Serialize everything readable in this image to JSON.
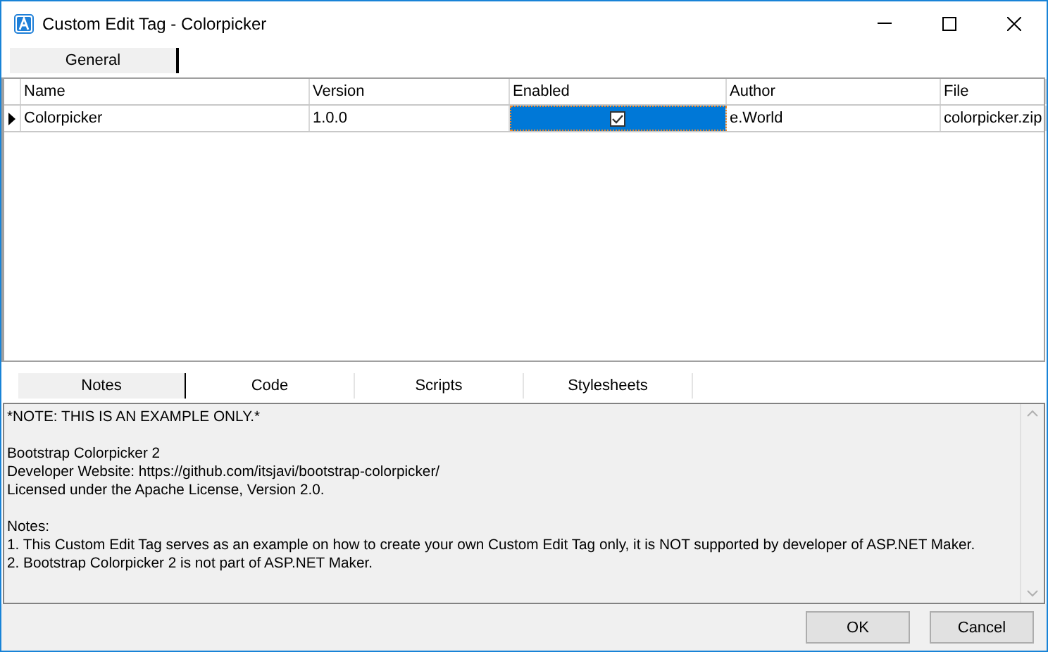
{
  "window": {
    "title": "Custom Edit Tag - Colorpicker"
  },
  "top_tabs": [
    {
      "label": "General",
      "selected": true
    }
  ],
  "table": {
    "columns": [
      "Name",
      "Version",
      "Enabled",
      "Author",
      "File"
    ],
    "rows": [
      {
        "current": true,
        "name": "Colorpicker",
        "version": "1.0.0",
        "enabled": true,
        "enabled_selected": true,
        "author": "e.World",
        "file": "colorpicker.zip"
      }
    ]
  },
  "bottom_tabs": [
    {
      "label": "Notes",
      "selected": true
    },
    {
      "label": "Code",
      "selected": false
    },
    {
      "label": "Scripts",
      "selected": false
    },
    {
      "label": "Stylesheets",
      "selected": false
    }
  ],
  "notes": [
    [
      "*NOTE: THIS IS AN EXAMPLE ONLY.*"
    ],
    [
      "Bootstrap Colorpicker 2",
      "Developer Website: https://github.com/itsjavi/bootstrap-colorpicker/",
      "Licensed under the Apache License, Version 2.0."
    ],
    [
      "Notes:",
      "1. This Custom Edit Tag serves as an example on how to create your own Custom Edit Tag only, it is NOT supported by developer of ASP.NET Maker.",
      "2. Bootstrap Colorpicker 2 is not part of ASP.NET Maker."
    ]
  ],
  "buttons": [
    "OK",
    "Cancel"
  ]
}
